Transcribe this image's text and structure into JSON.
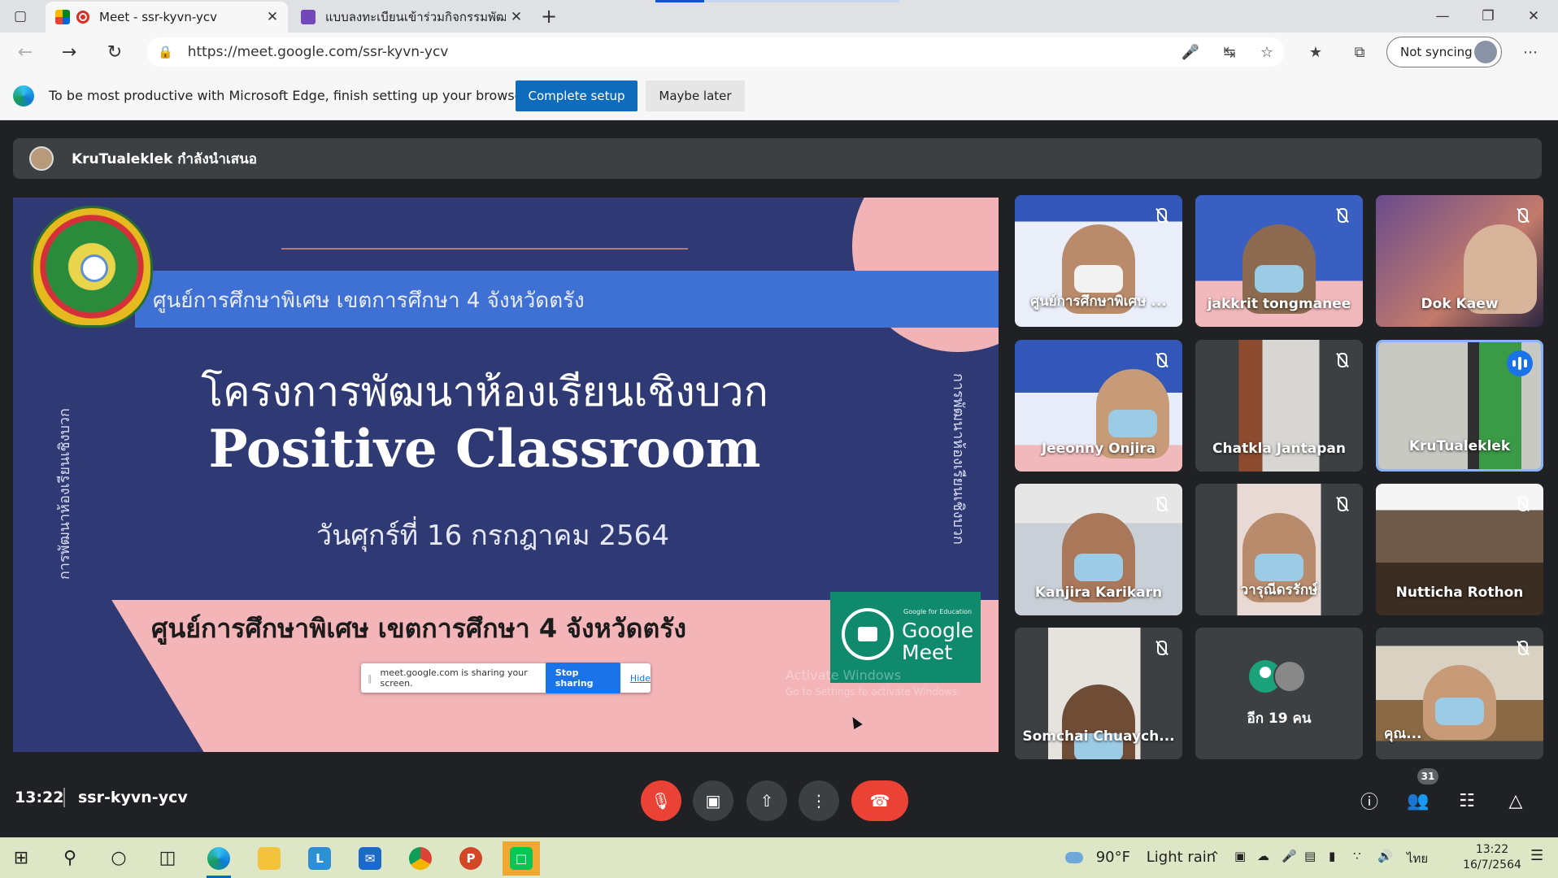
{
  "browser": {
    "tabs": [
      {
        "title": "Meet - ssr-kyvn-ycv",
        "active": true
      },
      {
        "title": "แบบลงทะเบียนเข้าร่วมกิจกรรมพัฒนา",
        "active": false
      }
    ],
    "url": "https://meet.google.com/ssr-kyvn-ycv",
    "sync_label": "Not syncing"
  },
  "infobar": {
    "message": "To be most productive with Microsoft Edge, finish setting up your browser.",
    "primary_label": "Complete setup",
    "secondary_label": "Maybe later"
  },
  "meet": {
    "presenter_text": "KruTualeklek กำลังนำเสนอ",
    "slide": {
      "banner": "ศูนย์การศึกษาพิเศษ เขตการศึกษา 4 จังหวัดตรัง",
      "side_text": "การพัฒนาห้องเรียนเชิงบวก",
      "title_th": "โครงการพัฒนาห้องเรียนเชิงบวก",
      "title_en": "Positive Classroom",
      "date": "วันศุกร์ที่ 16 กรกฎาคม 2564",
      "bottom": "ศูนย์การศึกษาพิเศษ เขตการศึกษา 4 จังหวัดตรัง",
      "meet_logo_small": "Google for Education",
      "meet_logo_name": "Google Meet",
      "share_notice": "meet.google.com is sharing your screen.",
      "stop_sharing": "Stop sharing",
      "hide": "Hide",
      "activate_title": "Activate Windows",
      "activate_sub": "Go to Settings to activate Windows."
    },
    "participants": [
      {
        "name": "ศูนย์การศึกษาพิเศษ ...",
        "muted": true
      },
      {
        "name": "jakkrit tongmanee",
        "muted": true
      },
      {
        "name": "Dok Kaew",
        "muted": true
      },
      {
        "name": "Jeeonny Onjira",
        "muted": true
      },
      {
        "name": "Chatkla Jantapan",
        "muted": true
      },
      {
        "name": "KruTualeklek",
        "muted": false
      },
      {
        "name": "Kanjira Karikarn",
        "muted": true
      },
      {
        "name": "วารุณีดรรักษ์",
        "muted": true
      },
      {
        "name": "Nutticha Rothon",
        "muted": true
      },
      {
        "name": "Somchai Chuaych...",
        "muted": true
      },
      {
        "name": "คุณ...",
        "muted": true
      }
    ],
    "more_label": "อีก 19 คน",
    "meeting_time": "13:22",
    "meeting_code": "ssr-kyvn-ycv",
    "participant_count": "31"
  },
  "taskbar": {
    "temperature": "90°F",
    "weather": "Light rain",
    "language": "ไทย",
    "time": "13:22",
    "date": "16/7/2564"
  },
  "colors": {
    "meet_bg": "#202124",
    "tile_bg": "#3c4043",
    "leave_red": "#ea4335",
    "edge_blue": "#0f6cbd",
    "slide_navy": "#2f3a75",
    "slide_pink": "#f3b5b8"
  }
}
